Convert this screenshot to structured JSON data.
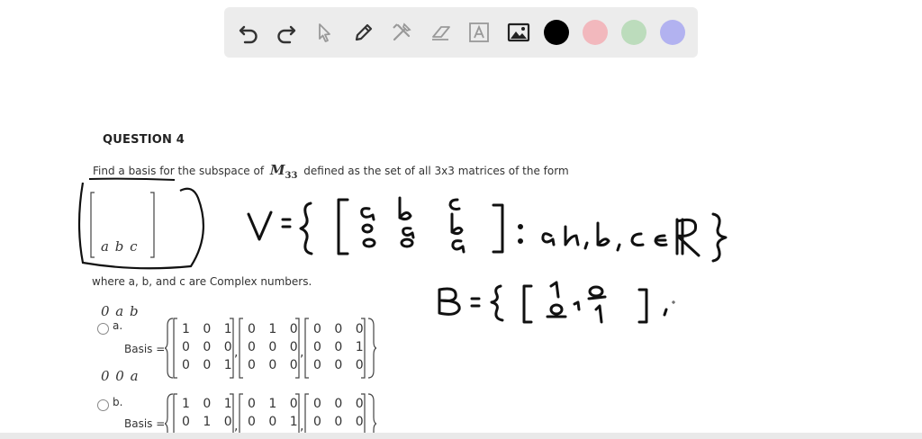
{
  "toolbar": {
    "tools": [
      {
        "name": "undo-icon"
      },
      {
        "name": "redo-icon"
      },
      {
        "name": "select-arrow-icon"
      },
      {
        "name": "pen-icon"
      },
      {
        "name": "tools-icon"
      },
      {
        "name": "eraser-icon"
      },
      {
        "name": "text-tool-icon"
      },
      {
        "name": "image-icon"
      }
    ],
    "colors": [
      "#000000",
      "#f2b8bd",
      "#bcdcbc",
      "#b2b2f0"
    ]
  },
  "question": {
    "title": "QUESTION 4",
    "text_before": "Find a basis for the subspace of",
    "symbol": "M",
    "symbol_sub": "33",
    "text_after": "defined as the set of all 3x3 matrices of the form",
    "form_rows": [
      "a b c",
      "0 a b",
      "0 0 a"
    ],
    "where": "where a, b, and c are Complex numbers."
  },
  "options": [
    {
      "letter": "a.",
      "label": "Basis =",
      "matrices": [
        [
          "1 0 1",
          "0 0 0",
          "0 0 1"
        ],
        [
          "0 1 0",
          "0 0 0",
          "0 0 0"
        ],
        [
          "0 0 0",
          "0 0 1",
          "0 0 0"
        ]
      ]
    },
    {
      "letter": "b.",
      "label": "Basis =",
      "matrices": [
        [
          "1 0 1",
          "0 1 0"
        ],
        [
          "0 1 0",
          "0 0 1"
        ],
        [
          "0 0 0",
          "0 0 0"
        ]
      ]
    }
  ],
  "handwriting": {
    "line1": "V = { [ a b c ; 0 a b ; 0 0 a ] : a, b, c ∈ R }",
    "line2": "B = { [ 1 0 ; 0 1 ] ,"
  }
}
